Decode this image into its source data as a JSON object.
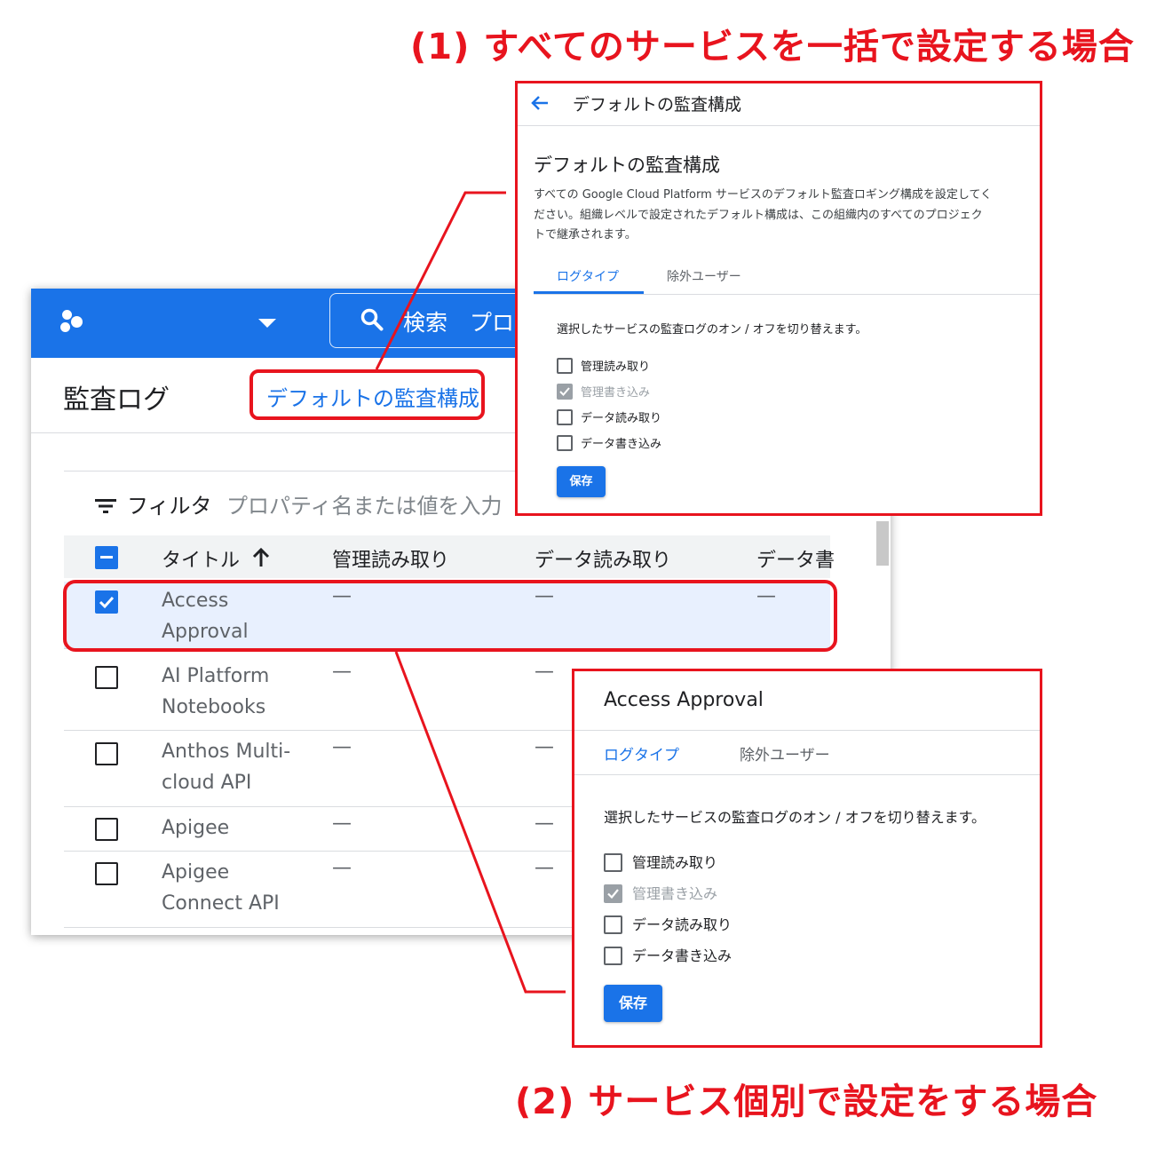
{
  "captions": {
    "top": "(1) すべてのサービスを一括で設定する場合",
    "bottom": "(2) サービス個別で設定をする場合"
  },
  "console": {
    "search_text": "検索　プロ",
    "page_title": "監査ログ",
    "default_config_link": "デフォルトの監査構成",
    "filter_label": "フィルタ",
    "filter_placeholder": "プロパティ名または値を入力",
    "columns": [
      "タイトル",
      "管理読み取り",
      "データ読み取り",
      "データ書"
    ],
    "sort_icon": "arrow-up-icon",
    "rows": [
      {
        "line1": "Access",
        "line2": "Approval",
        "checked": true,
        "c1": "—",
        "c2": "—",
        "c3": "—"
      },
      {
        "line1": "AI Platform",
        "line2": "Notebooks",
        "checked": false,
        "c1": "—",
        "c2": "—"
      },
      {
        "line1": "Anthos Multi-",
        "line2": "cloud API",
        "checked": false,
        "c1": "—",
        "c2": "—"
      },
      {
        "line1": "Apigee",
        "line2": "",
        "checked": false,
        "c1": "—",
        "c2": "—"
      },
      {
        "line1": "Apigee",
        "line2": "Connect API",
        "checked": false,
        "c1": "—",
        "c2": "—"
      }
    ]
  },
  "default_panel": {
    "header": "デフォルトの監査構成",
    "title": "デフォルトの監査構成",
    "desc1": "すべての Google Cloud Platform サービスのデフォルト監査ロギング構成を設定してく",
    "desc2": "ださい。組織レベルで設定されたデフォルト構成は、この組織内のすべてのプロジェク",
    "desc3": "トで継承されます。",
    "tab_log_type": "ログタイプ",
    "tab_excluded": "除外ユーザー",
    "instruction": "選択したサービスの監査ログのオン / オフを切り替えます。",
    "options": [
      "管理読み取り",
      "管理書き込み",
      "データ読み取り",
      "データ書き込み"
    ],
    "save": "保存"
  },
  "service_panel": {
    "title": "Access Approval",
    "tab_log_type": "ログタイプ",
    "tab_excluded": "除外ユーザー",
    "instruction": "選択したサービスの監査ログのオン / オフを切り替えます。",
    "options": [
      "管理読み取り",
      "管理書き込み",
      "データ読み取り",
      "データ書き込み"
    ],
    "save": "保存"
  },
  "colors": {
    "accent": "#1a73e8",
    "highlight": "#e8141e",
    "selected_row": "#e8f0fe"
  }
}
